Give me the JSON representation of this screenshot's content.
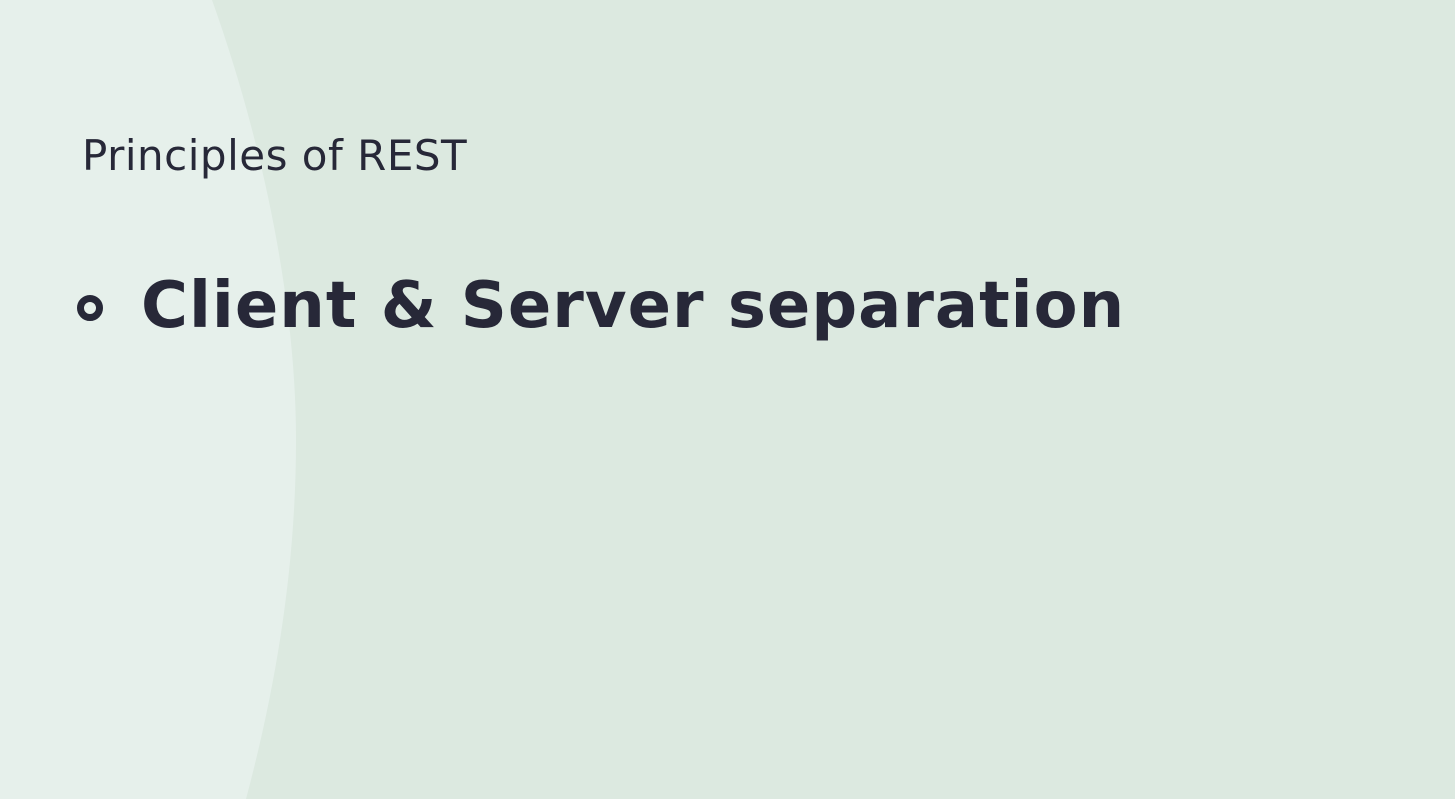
{
  "slide": {
    "colors": {
      "background": "#dce9e0",
      "accent_shape": "#e6f0eb",
      "text": "#272838"
    },
    "section_title": "Principles of REST",
    "bullets": [
      {
        "icon": "hollow-circle-bullet-icon",
        "text": "Client & Server separation"
      }
    ]
  }
}
